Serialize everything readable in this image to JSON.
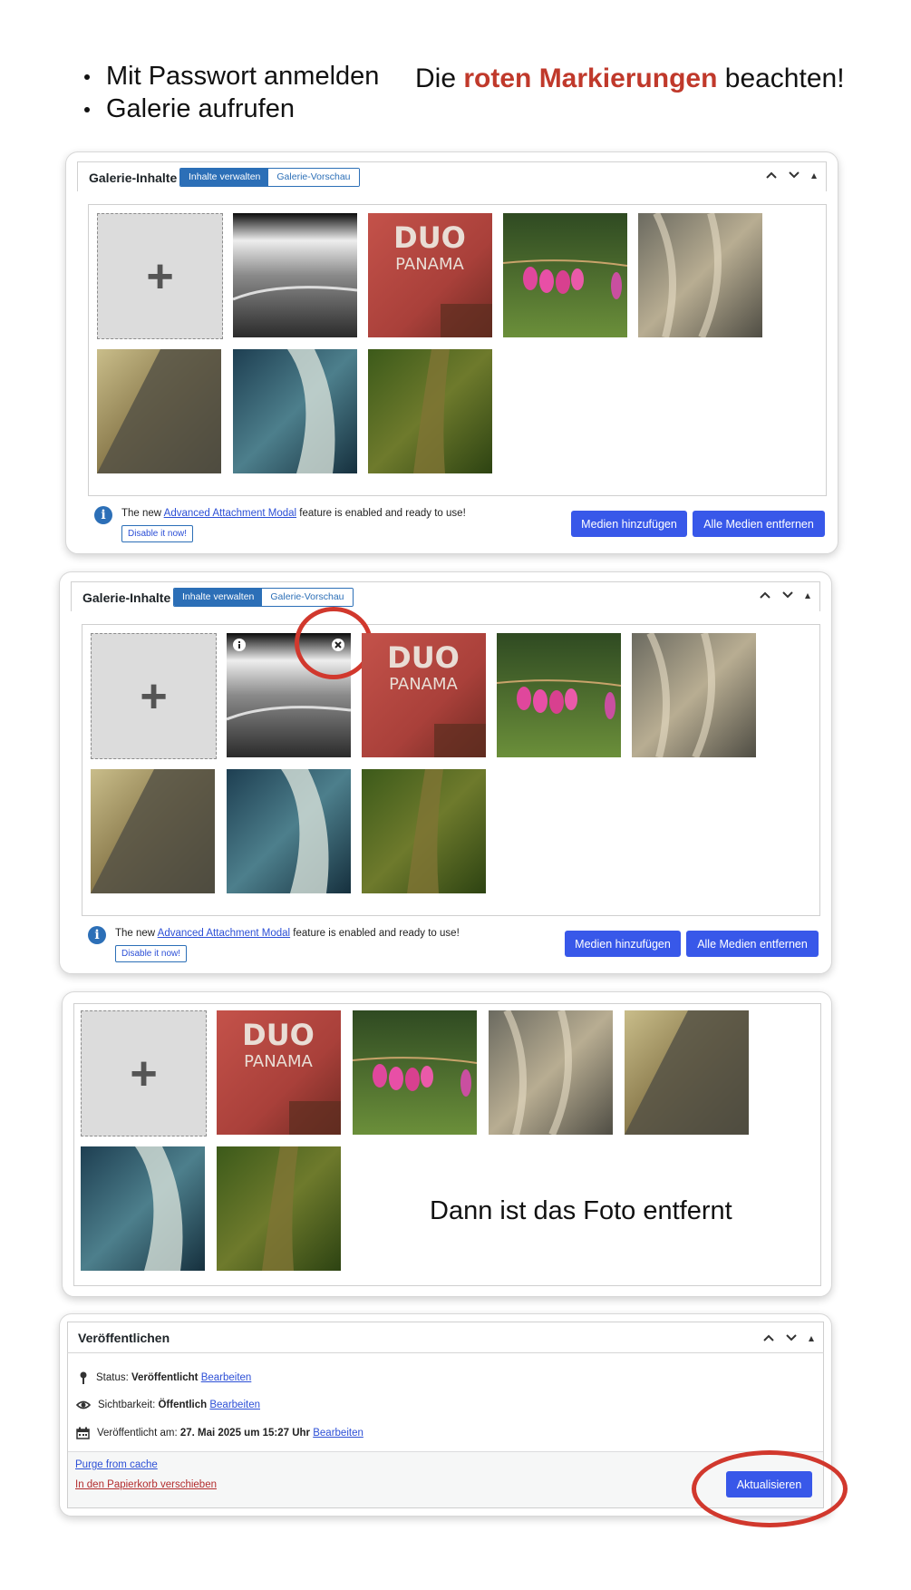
{
  "instructions": {
    "steps": [
      "Mit Passwort anmelden",
      "Galerie aufrufen"
    ],
    "hint_prefix": "Die ",
    "hint_emphasis": "roten Markierungen",
    "hint_suffix": " beachten!"
  },
  "gallery_panel": {
    "title": "Galerie-Inhalte",
    "tab_manage": "Inhalte verwalten",
    "tab_preview": "Galerie-Vorschau",
    "add_symbol": "+",
    "notice_prefix": "The new ",
    "notice_link": "Advanced Attachment Modal",
    "notice_suffix": " feature is enabled and ready to use!",
    "disable_label": "Disable it now!",
    "add_media_label": "Medien hinzufügen",
    "remove_all_label": "Alle Medien entfernen",
    "info_glyph": "i"
  },
  "result_caption": "Dann ist das Foto entfernt",
  "publish_panel": {
    "title": "Veröffentlichen",
    "status_label": "Status: ",
    "status_value": "Veröffentlicht",
    "visibility_label": "Sichtbarkeit: ",
    "visibility_value": "Öffentlich",
    "published_label": "Veröffentlicht am: ",
    "published_value": "27. Mai 2025 um 15:27 Uhr",
    "edit_label": "Bearbeiten",
    "purge_label": "Purge from cache",
    "trash_label": "In den Papierkorb verschieben",
    "update_label": "Aktualisieren"
  },
  "colors": {
    "accent": "#3858e9",
    "tab_blue": "#2c6fb7",
    "marker_red": "#d1382d",
    "trash_red": "#b32d2e"
  }
}
